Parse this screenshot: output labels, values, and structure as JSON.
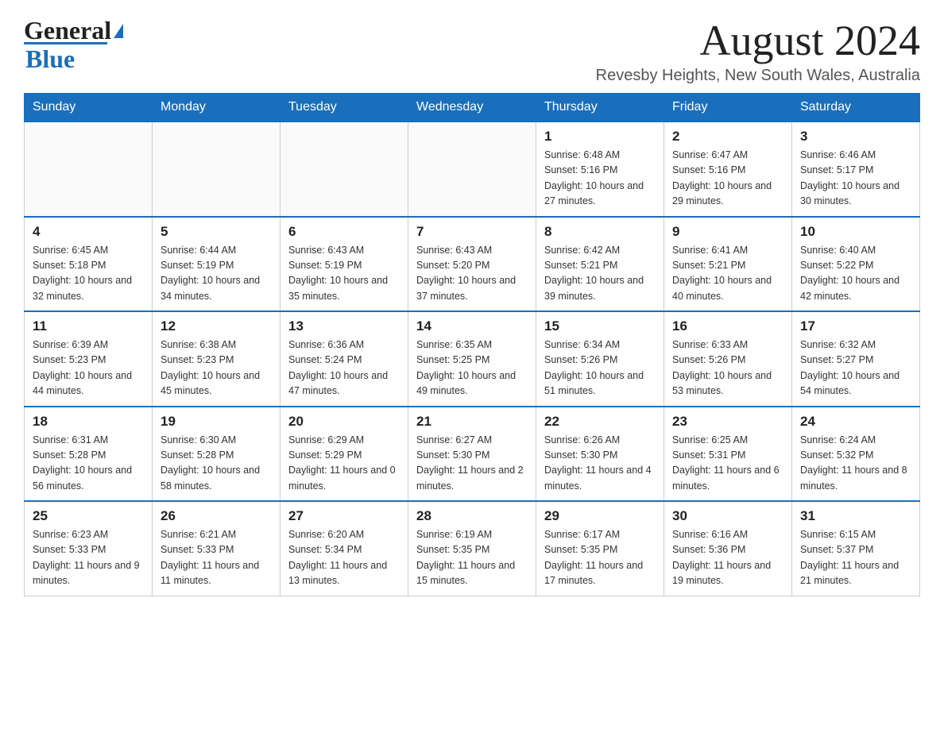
{
  "header": {
    "logo_general": "General",
    "logo_blue": "Blue",
    "month_year": "August 2024",
    "location": "Revesby Heights, New South Wales, Australia"
  },
  "days_of_week": [
    "Sunday",
    "Monday",
    "Tuesday",
    "Wednesday",
    "Thursday",
    "Friday",
    "Saturday"
  ],
  "weeks": [
    [
      {
        "day": "",
        "sunrise": "",
        "sunset": "",
        "daylight": ""
      },
      {
        "day": "",
        "sunrise": "",
        "sunset": "",
        "daylight": ""
      },
      {
        "day": "",
        "sunrise": "",
        "sunset": "",
        "daylight": ""
      },
      {
        "day": "",
        "sunrise": "",
        "sunset": "",
        "daylight": ""
      },
      {
        "day": "1",
        "sunrise": "Sunrise: 6:48 AM",
        "sunset": "Sunset: 5:16 PM",
        "daylight": "Daylight: 10 hours and 27 minutes."
      },
      {
        "day": "2",
        "sunrise": "Sunrise: 6:47 AM",
        "sunset": "Sunset: 5:16 PM",
        "daylight": "Daylight: 10 hours and 29 minutes."
      },
      {
        "day": "3",
        "sunrise": "Sunrise: 6:46 AM",
        "sunset": "Sunset: 5:17 PM",
        "daylight": "Daylight: 10 hours and 30 minutes."
      }
    ],
    [
      {
        "day": "4",
        "sunrise": "Sunrise: 6:45 AM",
        "sunset": "Sunset: 5:18 PM",
        "daylight": "Daylight: 10 hours and 32 minutes."
      },
      {
        "day": "5",
        "sunrise": "Sunrise: 6:44 AM",
        "sunset": "Sunset: 5:19 PM",
        "daylight": "Daylight: 10 hours and 34 minutes."
      },
      {
        "day": "6",
        "sunrise": "Sunrise: 6:43 AM",
        "sunset": "Sunset: 5:19 PM",
        "daylight": "Daylight: 10 hours and 35 minutes."
      },
      {
        "day": "7",
        "sunrise": "Sunrise: 6:43 AM",
        "sunset": "Sunset: 5:20 PM",
        "daylight": "Daylight: 10 hours and 37 minutes."
      },
      {
        "day": "8",
        "sunrise": "Sunrise: 6:42 AM",
        "sunset": "Sunset: 5:21 PM",
        "daylight": "Daylight: 10 hours and 39 minutes."
      },
      {
        "day": "9",
        "sunrise": "Sunrise: 6:41 AM",
        "sunset": "Sunset: 5:21 PM",
        "daylight": "Daylight: 10 hours and 40 minutes."
      },
      {
        "day": "10",
        "sunrise": "Sunrise: 6:40 AM",
        "sunset": "Sunset: 5:22 PM",
        "daylight": "Daylight: 10 hours and 42 minutes."
      }
    ],
    [
      {
        "day": "11",
        "sunrise": "Sunrise: 6:39 AM",
        "sunset": "Sunset: 5:23 PM",
        "daylight": "Daylight: 10 hours and 44 minutes."
      },
      {
        "day": "12",
        "sunrise": "Sunrise: 6:38 AM",
        "sunset": "Sunset: 5:23 PM",
        "daylight": "Daylight: 10 hours and 45 minutes."
      },
      {
        "day": "13",
        "sunrise": "Sunrise: 6:36 AM",
        "sunset": "Sunset: 5:24 PM",
        "daylight": "Daylight: 10 hours and 47 minutes."
      },
      {
        "day": "14",
        "sunrise": "Sunrise: 6:35 AM",
        "sunset": "Sunset: 5:25 PM",
        "daylight": "Daylight: 10 hours and 49 minutes."
      },
      {
        "day": "15",
        "sunrise": "Sunrise: 6:34 AM",
        "sunset": "Sunset: 5:26 PM",
        "daylight": "Daylight: 10 hours and 51 minutes."
      },
      {
        "day": "16",
        "sunrise": "Sunrise: 6:33 AM",
        "sunset": "Sunset: 5:26 PM",
        "daylight": "Daylight: 10 hours and 53 minutes."
      },
      {
        "day": "17",
        "sunrise": "Sunrise: 6:32 AM",
        "sunset": "Sunset: 5:27 PM",
        "daylight": "Daylight: 10 hours and 54 minutes."
      }
    ],
    [
      {
        "day": "18",
        "sunrise": "Sunrise: 6:31 AM",
        "sunset": "Sunset: 5:28 PM",
        "daylight": "Daylight: 10 hours and 56 minutes."
      },
      {
        "day": "19",
        "sunrise": "Sunrise: 6:30 AM",
        "sunset": "Sunset: 5:28 PM",
        "daylight": "Daylight: 10 hours and 58 minutes."
      },
      {
        "day": "20",
        "sunrise": "Sunrise: 6:29 AM",
        "sunset": "Sunset: 5:29 PM",
        "daylight": "Daylight: 11 hours and 0 minutes."
      },
      {
        "day": "21",
        "sunrise": "Sunrise: 6:27 AM",
        "sunset": "Sunset: 5:30 PM",
        "daylight": "Daylight: 11 hours and 2 minutes."
      },
      {
        "day": "22",
        "sunrise": "Sunrise: 6:26 AM",
        "sunset": "Sunset: 5:30 PM",
        "daylight": "Daylight: 11 hours and 4 minutes."
      },
      {
        "day": "23",
        "sunrise": "Sunrise: 6:25 AM",
        "sunset": "Sunset: 5:31 PM",
        "daylight": "Daylight: 11 hours and 6 minutes."
      },
      {
        "day": "24",
        "sunrise": "Sunrise: 6:24 AM",
        "sunset": "Sunset: 5:32 PM",
        "daylight": "Daylight: 11 hours and 8 minutes."
      }
    ],
    [
      {
        "day": "25",
        "sunrise": "Sunrise: 6:23 AM",
        "sunset": "Sunset: 5:33 PM",
        "daylight": "Daylight: 11 hours and 9 minutes."
      },
      {
        "day": "26",
        "sunrise": "Sunrise: 6:21 AM",
        "sunset": "Sunset: 5:33 PM",
        "daylight": "Daylight: 11 hours and 11 minutes."
      },
      {
        "day": "27",
        "sunrise": "Sunrise: 6:20 AM",
        "sunset": "Sunset: 5:34 PM",
        "daylight": "Daylight: 11 hours and 13 minutes."
      },
      {
        "day": "28",
        "sunrise": "Sunrise: 6:19 AM",
        "sunset": "Sunset: 5:35 PM",
        "daylight": "Daylight: 11 hours and 15 minutes."
      },
      {
        "day": "29",
        "sunrise": "Sunrise: 6:17 AM",
        "sunset": "Sunset: 5:35 PM",
        "daylight": "Daylight: 11 hours and 17 minutes."
      },
      {
        "day": "30",
        "sunrise": "Sunrise: 6:16 AM",
        "sunset": "Sunset: 5:36 PM",
        "daylight": "Daylight: 11 hours and 19 minutes."
      },
      {
        "day": "31",
        "sunrise": "Sunrise: 6:15 AM",
        "sunset": "Sunset: 5:37 PM",
        "daylight": "Daylight: 11 hours and 21 minutes."
      }
    ]
  ]
}
